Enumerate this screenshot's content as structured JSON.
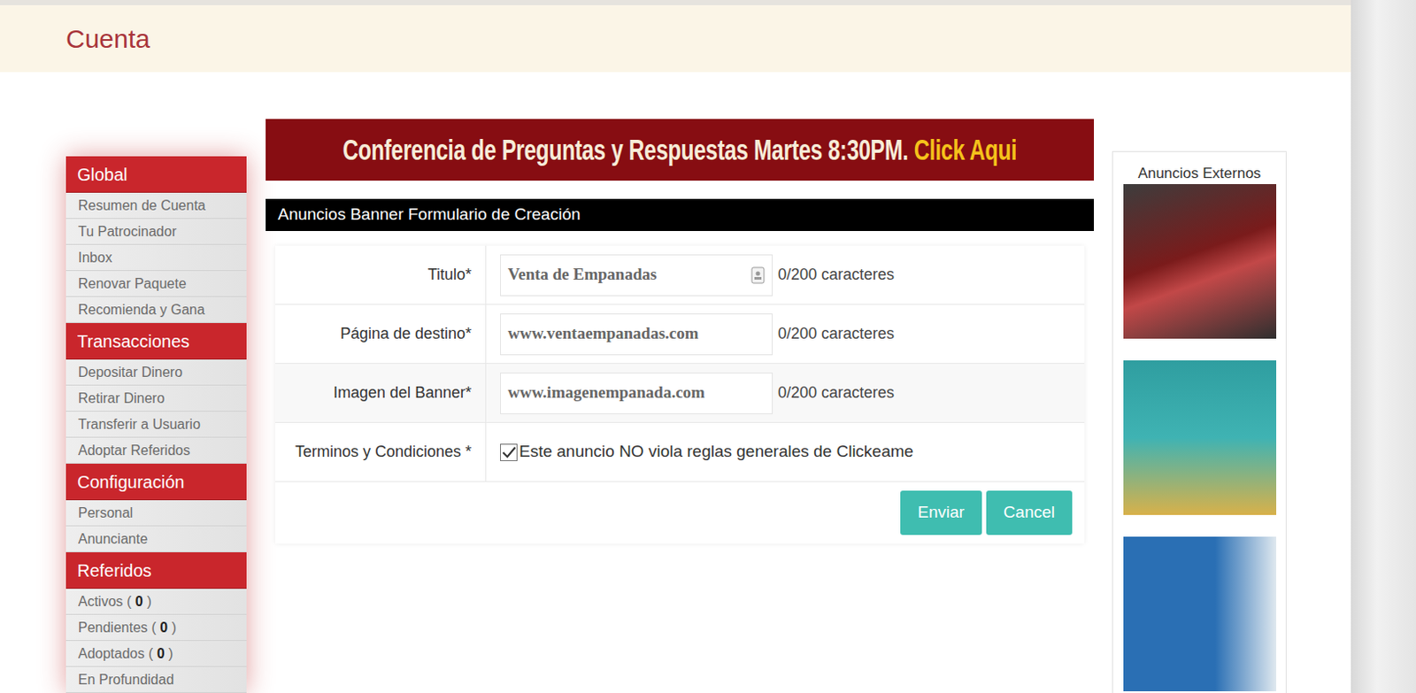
{
  "header": {
    "title": "Cuenta"
  },
  "banner": {
    "text": "Conferencia de Preguntas y Respuestas Martes 8:30PM.",
    "link": "Click Aqui"
  },
  "sidebar": {
    "sections": [
      {
        "title": "Global",
        "items": [
          {
            "label": "Resumen de Cuenta"
          },
          {
            "label": "Tu Patrocinador"
          },
          {
            "label": "Inbox"
          },
          {
            "label": "Renovar Paquete"
          },
          {
            "label": "Recomienda y Gana"
          }
        ]
      },
      {
        "title": "Transacciones",
        "items": [
          {
            "label": "Depositar Dinero"
          },
          {
            "label": "Retirar Dinero"
          },
          {
            "label": "Transferir a Usuario"
          },
          {
            "label": "Adoptar Referidos"
          }
        ]
      },
      {
        "title": "Configuración",
        "items": [
          {
            "label": "Personal"
          },
          {
            "label": "Anunciante"
          }
        ]
      },
      {
        "title": "Referidos",
        "items": [
          {
            "label": "Activos ( ",
            "count": "0",
            "tail": " )"
          },
          {
            "label": "Pendientes ( ",
            "count": "0",
            "tail": " )"
          },
          {
            "label": "Adoptados ( ",
            "count": "0",
            "tail": " )"
          },
          {
            "label": "En Profundidad"
          }
        ]
      }
    ]
  },
  "form": {
    "title": "Anuncios Banner Formulario de Creación",
    "fields": [
      {
        "label": "Titulo*",
        "value": "Venta de Empanadas",
        "counter": "0/200 caracteres",
        "kind": "icon"
      },
      {
        "label": "Página de destino*",
        "value": "www.ventaempanadas.com",
        "counter": "0/200 caracteres",
        "kind": "plain"
      },
      {
        "label": "Imagen del Banner*",
        "value": "www.imagenempanada.com",
        "counter": "0/200 caracteres",
        "kind": "plain"
      }
    ],
    "terms": {
      "label": "Terminos y Condiciones *",
      "text": "Este anuncio NO viola reglas generales de Clickeame",
      "checked": true
    },
    "buttons": [
      {
        "label": "Enviar"
      },
      {
        "label": "Cancel"
      }
    ]
  },
  "ads": {
    "title": "Anuncios Externos"
  }
}
